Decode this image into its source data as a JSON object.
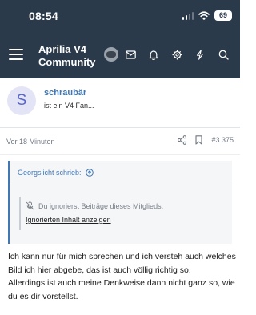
{
  "status_bar": {
    "time": "08:54",
    "battery": "69"
  },
  "nav": {
    "title": "Aprilia V4 Community",
    "icons": [
      "menu-icon",
      "avatar",
      "mail-icon",
      "bell-icon",
      "gear-icon",
      "bolt-icon",
      "search-icon"
    ]
  },
  "post": {
    "avatar_letter": "S",
    "username": "schraubär",
    "user_title": "ist ein V4 Fan...",
    "timestamp": "Vor 18 Minuten",
    "post_number": "#3.375",
    "quote": {
      "author": "Georgslicht schrieb:",
      "ignored_notice": "Du ignorierst Beiträge dieses Mitglieds.",
      "show_ignored_label": "Ignorierten Inhalt anzeigen"
    },
    "body_lines": [
      "Ich kann nur für mich sprechen und ich versteh auch welches Bild ich hier abgebe, das ist auch völlig richtig so.",
      "Allerdings ist auch meine Denkweise dann nicht ganz so, wie du es dir vorstellst."
    ]
  },
  "colors": {
    "header_bg": "#2b3a4a",
    "link": "#3f78b5",
    "avatar_bg": "#e3e5f6"
  }
}
